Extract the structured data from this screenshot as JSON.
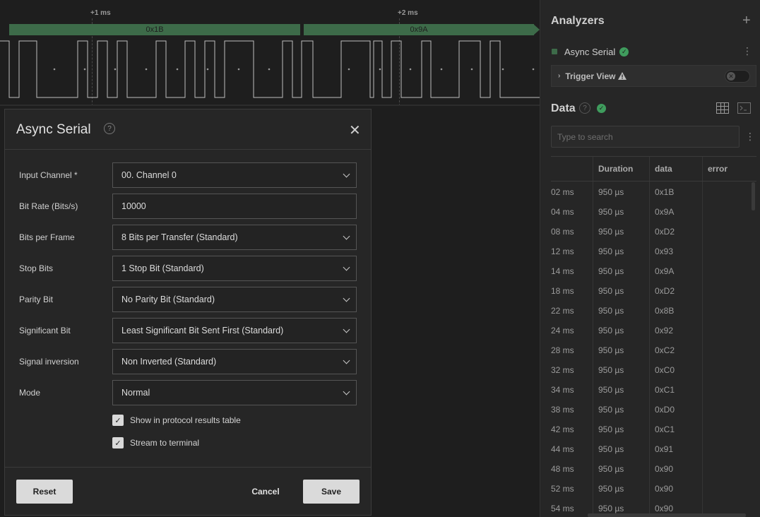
{
  "timeline": {
    "ticks": [
      {
        "label": "+1 ms"
      },
      {
        "label": "+2 ms"
      }
    ],
    "frames": [
      {
        "value": "0x1B"
      },
      {
        "value": "0x9A"
      }
    ]
  },
  "analyzers_panel": {
    "title": "Analyzers",
    "add_icon": "plus-icon",
    "analyzer_name": "Async Serial",
    "trigger_view_label": "Trigger View"
  },
  "data_panel": {
    "title": "Data",
    "search_placeholder": "Type to search",
    "columns": [
      "",
      "Duration",
      "data",
      "error"
    ],
    "rows": [
      {
        "time": "02 ms",
        "duration": "950 µs",
        "data": "0x1B",
        "error": ""
      },
      {
        "time": "04 ms",
        "duration": "950 µs",
        "data": "0x9A",
        "error": ""
      },
      {
        "time": "08 ms",
        "duration": "950 µs",
        "data": "0xD2",
        "error": ""
      },
      {
        "time": "12 ms",
        "duration": "950 µs",
        "data": "0x93",
        "error": ""
      },
      {
        "time": "14 ms",
        "duration": "950 µs",
        "data": "0x9A",
        "error": ""
      },
      {
        "time": "18 ms",
        "duration": "950 µs",
        "data": "0xD2",
        "error": ""
      },
      {
        "time": "22 ms",
        "duration": "950 µs",
        "data": "0x8B",
        "error": ""
      },
      {
        "time": "24 ms",
        "duration": "950 µs",
        "data": "0x92",
        "error": ""
      },
      {
        "time": "28 ms",
        "duration": "950 µs",
        "data": "0xC2",
        "error": ""
      },
      {
        "time": "32 ms",
        "duration": "950 µs",
        "data": "0xC0",
        "error": ""
      },
      {
        "time": "34 ms",
        "duration": "950 µs",
        "data": "0xC1",
        "error": ""
      },
      {
        "time": "38 ms",
        "duration": "950 µs",
        "data": "0xD0",
        "error": ""
      },
      {
        "time": "42 ms",
        "duration": "950 µs",
        "data": "0xC1",
        "error": ""
      },
      {
        "time": "44 ms",
        "duration": "950 µs",
        "data": "0x91",
        "error": ""
      },
      {
        "time": "48 ms",
        "duration": "950 µs",
        "data": "0x90",
        "error": ""
      },
      {
        "time": "52 ms",
        "duration": "950 µs",
        "data": "0x90",
        "error": ""
      },
      {
        "time": "54 ms",
        "duration": "950 µs",
        "data": "0x90",
        "error": ""
      }
    ]
  },
  "dialog": {
    "title": "Async Serial",
    "fields": [
      {
        "label": "Input Channel *",
        "value": "00.  Channel 0",
        "type": "select"
      },
      {
        "label": "Bit Rate (Bits/s)",
        "value": "10000",
        "type": "text"
      },
      {
        "label": "Bits per Frame",
        "value": "8 Bits per Transfer (Standard)",
        "type": "select"
      },
      {
        "label": "Stop Bits",
        "value": "1 Stop Bit (Standard)",
        "type": "select"
      },
      {
        "label": "Parity Bit",
        "value": "No Parity Bit (Standard)",
        "type": "select"
      },
      {
        "label": "Significant Bit",
        "value": "Least Significant Bit Sent First (Standard)",
        "type": "select"
      },
      {
        "label": "Signal inversion",
        "value": "Non Inverted (Standard)",
        "type": "select"
      },
      {
        "label": "Mode",
        "value": "Normal",
        "type": "select"
      }
    ],
    "checkboxes": [
      {
        "label": "Show in protocol results table",
        "checked": true
      },
      {
        "label": "Stream to terminal",
        "checked": true
      }
    ],
    "buttons": {
      "reset": "Reset",
      "cancel": "Cancel",
      "save": "Save"
    }
  },
  "colors": {
    "accent_green": "#3d6b49",
    "status_green": "#3f9c5d",
    "background": "#1e1e1e",
    "panel": "#262626"
  }
}
